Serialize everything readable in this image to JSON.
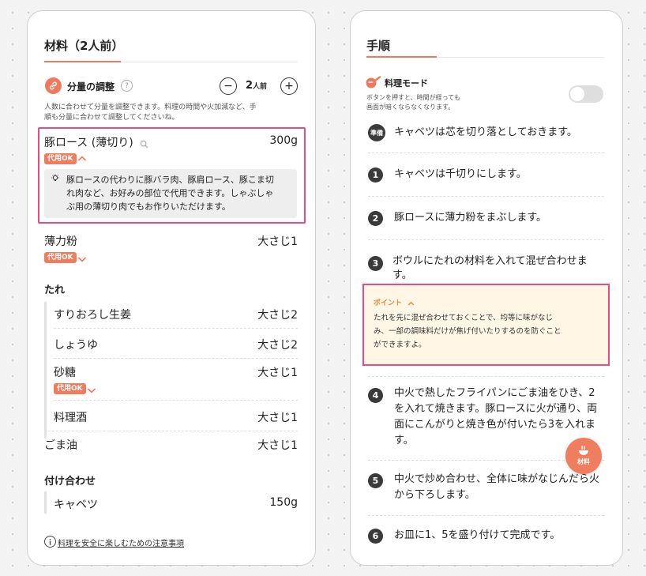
{
  "ingredients": {
    "title": "材料（2人前）",
    "adjust": {
      "label": "分量の調整",
      "help": "?",
      "minus": "−",
      "plus": "+",
      "count": "2",
      "unit": "人前",
      "note_line1": "人数に合わせて分量を調整できます。料理の時間や火加減など、手",
      "note_line2": "順も分量に合わせて調整してくださいね。"
    },
    "substitute_badge": "代用OK",
    "items": [
      {
        "name": "豚ロース (薄切り)",
        "amount": "300g"
      },
      {
        "name": "薄力粉",
        "amount": "大さじ1"
      }
    ],
    "highlight_tip": {
      "line1": "豚ロースの代わりに豚バラ肉、豚肩ロース、豚こま切",
      "line2": "れ肉など、お好みの部位で代用できます。しゃぶしゃ",
      "line3": "ぶ用の薄切り肉でもお作りいただけます。"
    },
    "sauce": {
      "heading": "たれ",
      "items": [
        {
          "name": "すりおろし生姜",
          "amount": "大さじ2"
        },
        {
          "name": "しょうゆ",
          "amount": "大さじ2"
        },
        {
          "name": "砂糖",
          "amount": "大さじ1"
        },
        {
          "name": "料理酒",
          "amount": "大さじ1"
        }
      ]
    },
    "sesame_oil": {
      "name": "ごま油",
      "amount": "大さじ1"
    },
    "garnish": {
      "heading": "付け合わせ",
      "items": [
        {
          "name": "キャベツ",
          "amount": "150g"
        }
      ]
    },
    "safety_link": "料理を安全に楽しむための注意事項"
  },
  "steps": {
    "title": "手順",
    "cooking_mode": {
      "label": "料理モード",
      "desc_line1": "ボタンを押すと、時間が経っても",
      "desc_line2": "画面が暗くならなくなります。",
      "enabled": false
    },
    "prep": {
      "label": "準備",
      "text": "キャベツは芯を切り落としておきます。"
    },
    "list": [
      {
        "num": "1",
        "lines": [
          "キャベツは千切りにします。"
        ]
      },
      {
        "num": "2",
        "lines": [
          "豚ロースに薄力粉をまぶします。"
        ]
      },
      {
        "num": "3",
        "lines": [
          "ボウルにたれの材料を入れて混ぜ合わせま",
          "す。"
        ]
      },
      {
        "num": "4",
        "lines": [
          "中火で熱したフライパンにごま油をひき、2",
          "を入れて焼きます。豚ロースに火が通り、両",
          "面にこんがりと焼き色が付いたら3を入れま",
          "す。"
        ]
      },
      {
        "num": "5",
        "lines": [
          "中火で炒め合わせ、全体に味がなじんだら火",
          "から下ろします。"
        ]
      },
      {
        "num": "6",
        "lines": [
          "お皿に1、5を盛り付けて完成です。"
        ]
      }
    ],
    "point": {
      "title": "ポイント",
      "line1": "たれを先に混ぜ合わせておくことで、均等に味がなじ",
      "line2": "み、一部の調味料だけが焦げ付いたりするのを防ぐこと",
      "line3": "ができますよ。"
    },
    "fab_label": "材料"
  },
  "colors": {
    "accent": "#ec7a5f",
    "highlight_border": "#e84a82",
    "point_bg": "#fff6e6"
  }
}
